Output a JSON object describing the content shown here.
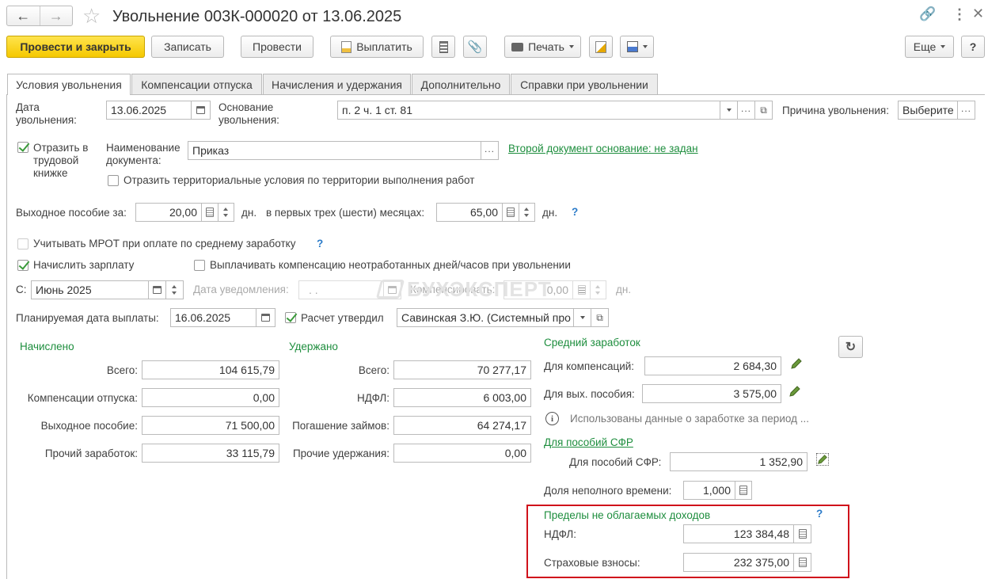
{
  "window": {
    "title": "Увольнение 003К-000020 от 13.06.2025"
  },
  "toolbar": {
    "post_close": "Провести и закрыть",
    "write": "Записать",
    "post": "Провести",
    "pay": "Выплатить",
    "print": "Печать",
    "more": "Еще",
    "help": "?"
  },
  "tabs": [
    "Условия увольнения",
    "Компенсации отпуска",
    "Начисления и удержания",
    "Дополнительно",
    "Справки при увольнении"
  ],
  "form": {
    "dismissal_date_label": "Дата\nувольнения:",
    "dismissal_date": "13.06.2025",
    "basis_label": "Основание\nувольнения:",
    "basis": "п. 2 ч. 1 ст. 81",
    "reason_label": "Причина увольнения:",
    "reason_value": "Выберите",
    "workbook_label": "Отразить в\nтрудовой\nкнижке",
    "docname_label": "Наименование\nдокумента:",
    "docname_value": "Приказ",
    "second_basis_link": "Второй документ основание: не задан",
    "territorial_label": "Отразить территориальные условия по территории выполнения работ",
    "severance_label": "Выходное пособие за:",
    "severance_days": "20,00",
    "days_unit": "дн.",
    "first_months_label": "в первых трех (шести) месяцах:",
    "first_months_days": "65,00",
    "q": "?",
    "mrot_label": "Учитывать МРОТ при оплате по среднему заработку",
    "accrue_salary_label": "Начислить зарплату",
    "pay_comp_label": "Выплачивать компенсацию неотработанных дней/часов при увольнении",
    "from_label": "С:",
    "from_value": "Июнь 2025",
    "notice_date_label": "Дата уведомления:",
    "notice_date_value": ". .",
    "compensate_label": "Компенсировать:",
    "compensate_value": "0,00",
    "planned_pay_label": "Планируемая дата выплаты:",
    "planned_pay_value": "16.06.2025",
    "approved_label": "Расчет утвердил",
    "approved_value": "Савинская З.Ю. (Системный про"
  },
  "accrued": {
    "header": "Начислено",
    "rows": [
      {
        "label": "Всего:",
        "value": "104 615,79"
      },
      {
        "label": "Компенсации отпуска:",
        "value": "0,00"
      },
      {
        "label": "Выходное пособие:",
        "value": "71 500,00"
      },
      {
        "label": "Прочий заработок:",
        "value": "33 115,79"
      }
    ]
  },
  "withheld": {
    "header": "Удержано",
    "rows": [
      {
        "label": "Всего:",
        "value": "70 277,17"
      },
      {
        "label": "НДФЛ:",
        "value": "6 003,00"
      },
      {
        "label": "Погашение займов:",
        "value": "64 274,17"
      },
      {
        "label": "Прочие удержания:",
        "value": "0,00"
      }
    ]
  },
  "average": {
    "header": "Средний заработок",
    "comp_label": "Для компенсаций:",
    "comp_value": "2 684,30",
    "sev_label": "Для вых. пособия:",
    "sev_value": "3 575,00",
    "info": "Использованы данные о заработке за период ...",
    "sfr_link": "Для пособий СФР",
    "sfr_label": "Для пособий СФР:",
    "sfr_value": "1 352,90",
    "parttime_label": "Доля неполного времени:",
    "parttime_value": "1,000"
  },
  "limits": {
    "header": "Пределы не облагаемых доходов",
    "ndfl_label": "НДФЛ:",
    "ndfl_value": "123 384,48",
    "ins_label": "Страховые взносы:",
    "ins_value": "232 375,00"
  },
  "watermark": "БУХЭКСПЕРТ",
  "colors": {
    "accent_green": "#1e8e3e",
    "primary_yellow": "#f5c800",
    "highlight_red": "#d0121b",
    "help_blue": "#2b7bc9"
  }
}
